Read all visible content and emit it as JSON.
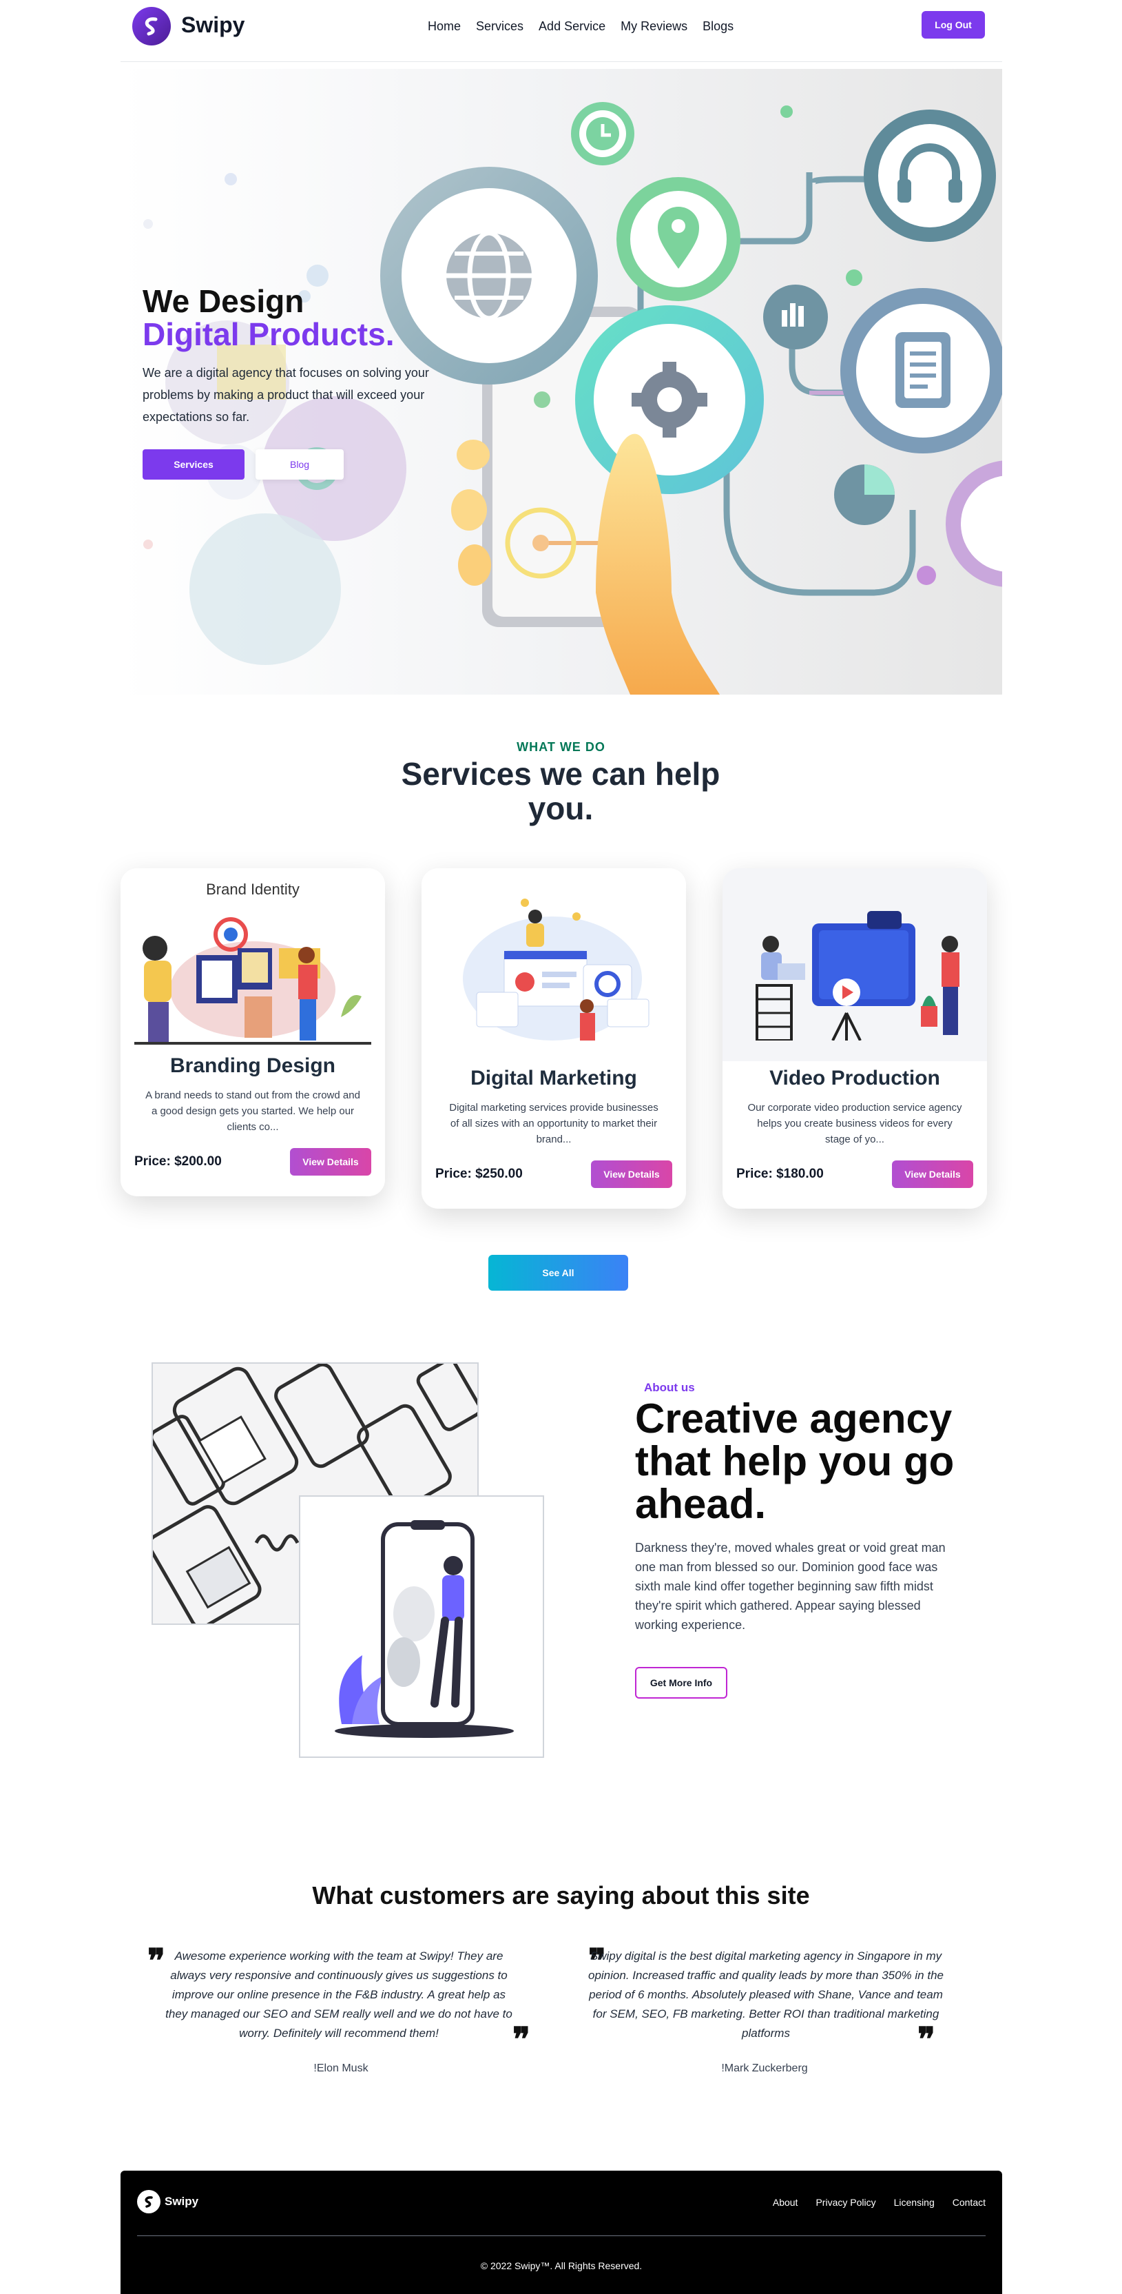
{
  "brand": {
    "name": "Swipy",
    "accent": "#7c3aed"
  },
  "nav": {
    "links": [
      "Home",
      "Services",
      "Add Service",
      "My Reviews",
      "Blogs"
    ],
    "logout_label": "Log Out"
  },
  "hero": {
    "title_line1": "We Design",
    "title_line2": "Digital Products.",
    "description": "We are a digital agency that focuses on solving your problems by making a product that will exceed your expectations so far.",
    "primary_button": "Services",
    "secondary_button": "Blog"
  },
  "services": {
    "eyebrow": "WHAT WE DO",
    "title": "Services we can help you.",
    "cards": [
      {
        "image_label": "Brand Identity",
        "title": "Branding Design",
        "description": "A brand needs to stand out from the crowd and a good design gets you started. We help our clients co...",
        "price": "Price: $200.00",
        "button": "View Details"
      },
      {
        "title": "Digital Marketing",
        "description": "Digital marketing services provide businesses of all sizes with an opportunity to market their brand...",
        "price": "Price: $250.00",
        "button": "View Details"
      },
      {
        "title": "Video Production",
        "description": "Our corporate video production service agency helps you create business videos for every stage of yo...",
        "price": "Price: $180.00",
        "button": "View Details"
      }
    ],
    "see_all": "See All"
  },
  "about": {
    "eyebrow": "About us",
    "title": "Creative agency that help you go ahead.",
    "description": "Darkness they're, moved whales great or void great man one man from blessed so our. Dominion good face was sixth male kind offer together beginning saw fifth midst they're spirit which gathered. Appear saying blessed working experience.",
    "button": "Get More Info"
  },
  "testimonials": {
    "title": "What customers are saying about this site",
    "items": [
      {
        "quote": "Awesome experience working with the team at Swipy! They are always very responsive and continuously gives us suggestions to improve our online presence in the F&B industry. A great help as they managed our SEO and SEM really well and we do not have to worry. Definitely will recommend them!",
        "author": "!Elon Musk"
      },
      {
        "quote": "Swipy digital is the best digital marketing agency in Singapore in my opinion. Increased traffic and quality leads by more than 350% in the period of 6 months. Absolutely pleased with Shane, Vance and team for SEM, SEO, FB marketing. Better ROI than traditional marketing platforms",
        "author": "!Mark Zuckerberg"
      }
    ]
  },
  "footer": {
    "brand": "Swipy",
    "links": [
      "About",
      "Privacy Policy",
      "Licensing",
      "Contact"
    ],
    "copyright": "© 2022 Swipy™. All Rights Reserved."
  }
}
